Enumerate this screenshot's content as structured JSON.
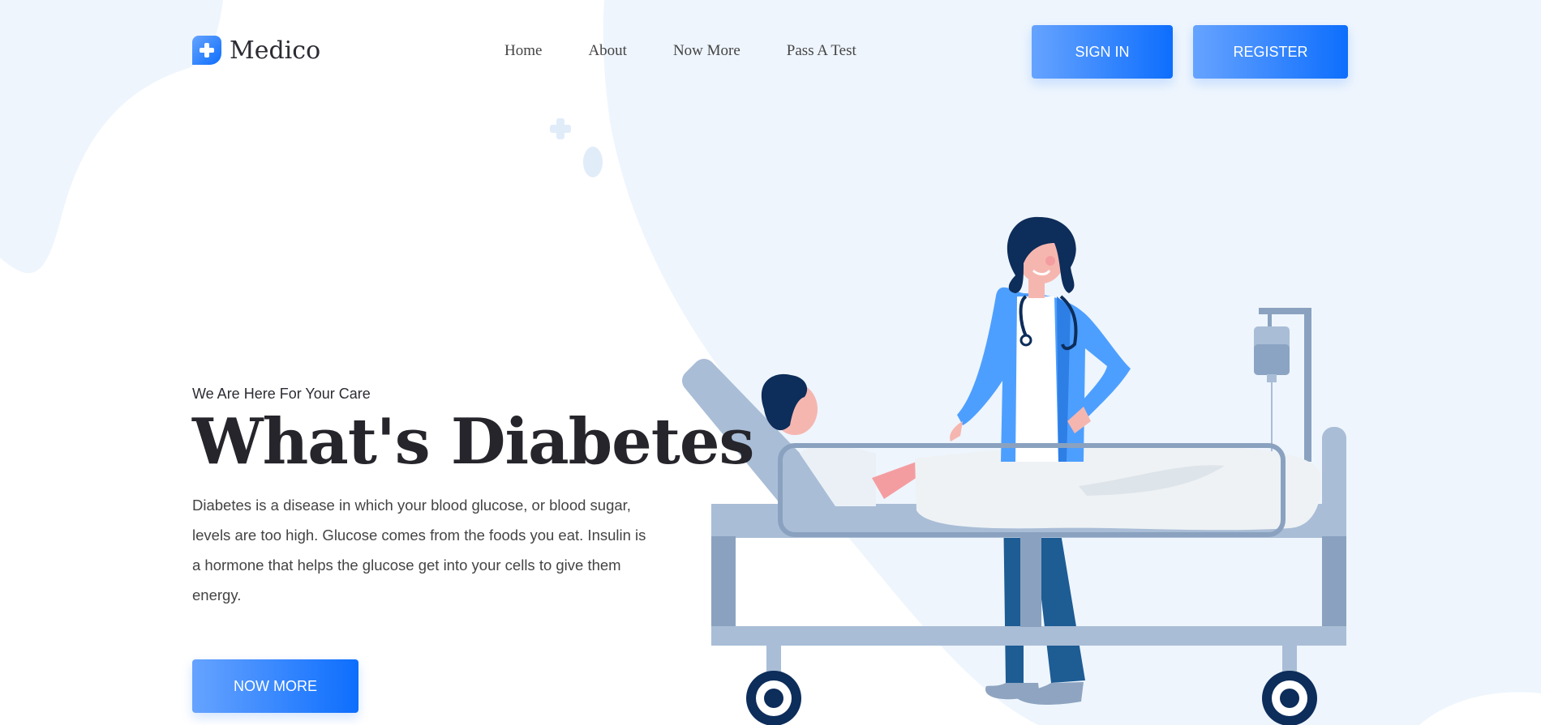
{
  "brand": {
    "name": "Medico",
    "accent": "#0d6efd",
    "accent_light": "#66a3ff",
    "logo_icon": "medical-cross-icon"
  },
  "nav": {
    "items": [
      {
        "label": "Home"
      },
      {
        "label": "About"
      },
      {
        "label": "Now More"
      },
      {
        "label": "Pass A Test"
      }
    ]
  },
  "auth": {
    "signin_label": "SIGN IN",
    "register_label": "REGISTER"
  },
  "hero": {
    "eyebrow": "We Are Here For Your Care",
    "title": "What's Diabetes",
    "description": "Diabetes is a disease in which your blood glucose, or blood sugar, levels are too high. Glucose comes from the foods you eat. Insulin is a hormone that helps the glucose get into your cells to give them energy.",
    "cta_label": "NOW MORE"
  },
  "illustration": {
    "subject": "doctor-and-patient-illustration"
  }
}
